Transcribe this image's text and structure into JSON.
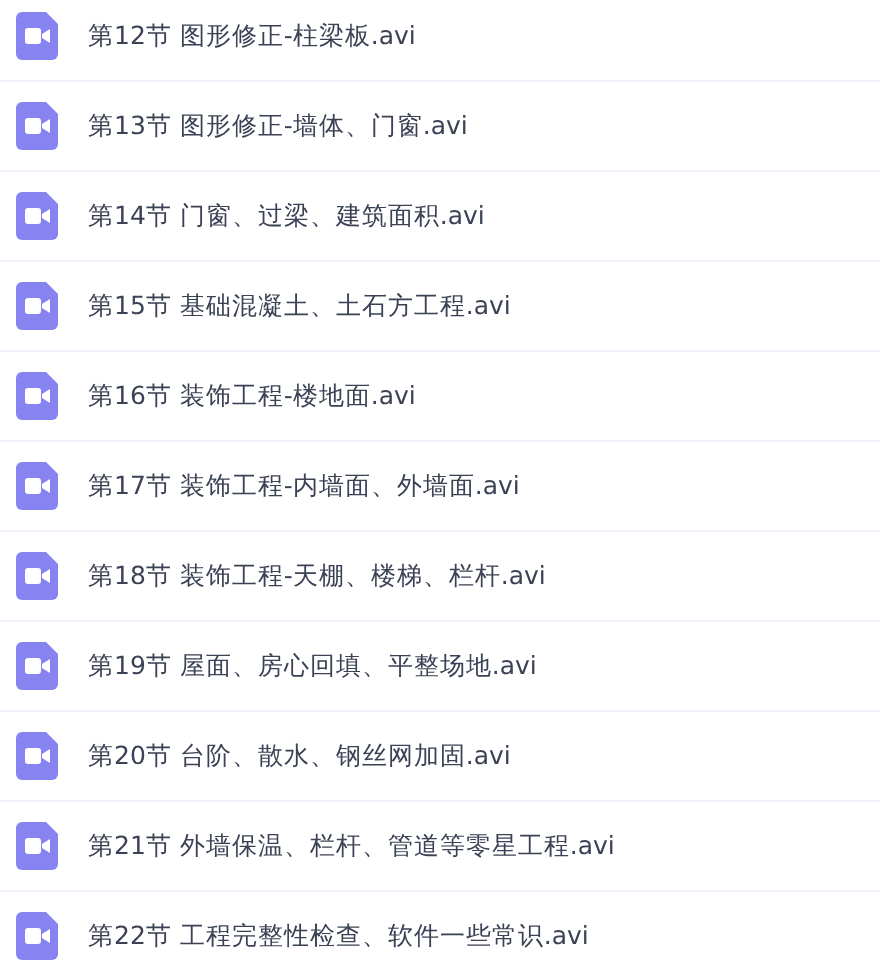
{
  "files": [
    {
      "name": "第12节 图形修正-柱梁板.avi"
    },
    {
      "name": "第13节 图形修正-墙体、门窗.avi"
    },
    {
      "name": "第14节 门窗、过梁、建筑面积.avi"
    },
    {
      "name": "第15节 基础混凝土、土石方工程.avi"
    },
    {
      "name": "第16节 装饰工程-楼地面.avi"
    },
    {
      "name": "第17节 装饰工程-内墙面、外墙面.avi"
    },
    {
      "name": "第18节 装饰工程-天棚、楼梯、栏杆.avi"
    },
    {
      "name": "第19节 屋面、房心回填、平整场地.avi"
    },
    {
      "name": "第20节 台阶、散水、钢丝网加固.avi"
    },
    {
      "name": "第21节 外墙保温、栏杆、管道等零星工程.avi"
    },
    {
      "name": "第22节 工程完整性检查、软件一些常识.avi"
    }
  ]
}
